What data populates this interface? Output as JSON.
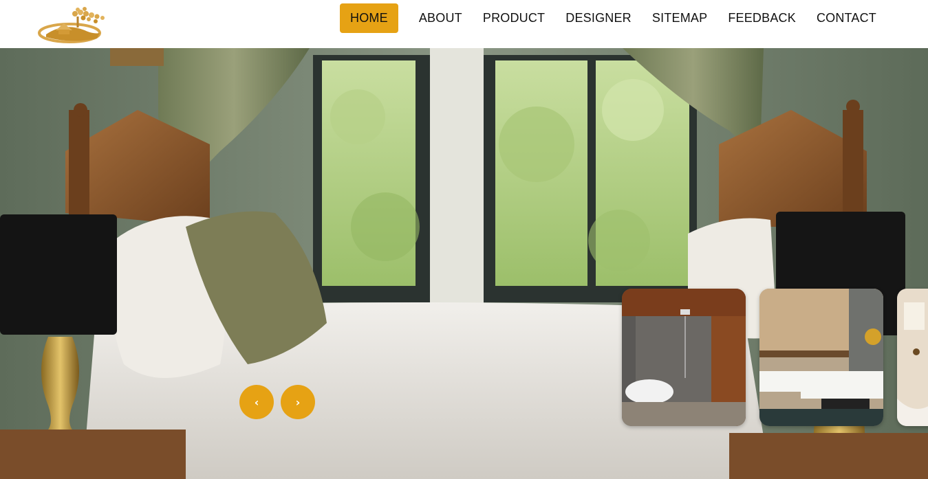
{
  "brand": {
    "logo": "house-tree-logo"
  },
  "nav": {
    "items": [
      {
        "label": "HOME",
        "active": true
      },
      {
        "label": "ABOUT",
        "active": false
      },
      {
        "label": "PRODUCT",
        "active": false
      },
      {
        "label": "DESIGNER",
        "active": false
      },
      {
        "label": "SITEMAP",
        "active": false
      },
      {
        "label": "FEEDBACK",
        "active": false
      },
      {
        "label": "CONTACT",
        "active": false
      }
    ]
  },
  "hero": {
    "image": "bedroom-window-seat-photo",
    "prev_icon": "‹",
    "next_icon": "›",
    "thumbnails": [
      {
        "image": "bathroom-interior"
      },
      {
        "image": "living-room-interior"
      },
      {
        "image": "bathtub-interior"
      }
    ]
  },
  "colors": {
    "accent": "#e6a214",
    "header_bg": "#ffffff"
  }
}
